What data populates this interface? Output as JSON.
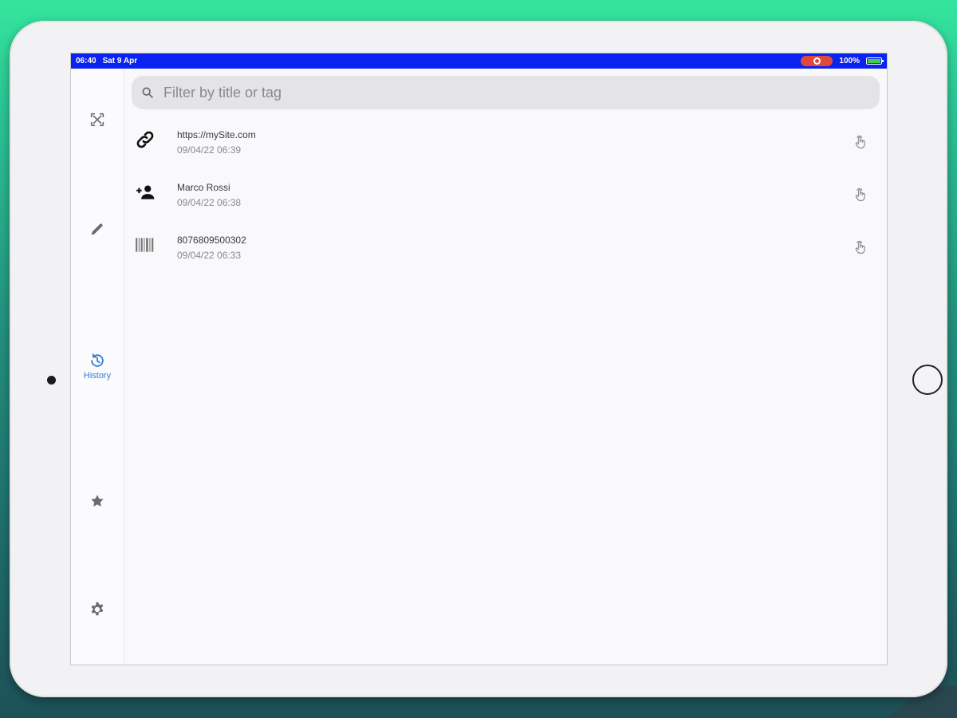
{
  "status_bar": {
    "time": "06:40",
    "date": "Sat 9 Apr",
    "battery_percent": "100%",
    "colors": {
      "background": "#0a23f0",
      "record_pill": "#e0483e",
      "battery": "#3ccf4e"
    }
  },
  "sidebar": {
    "items": [
      {
        "icon": "qr-scan-icon",
        "label": "",
        "active": false
      },
      {
        "icon": "pencil-icon",
        "label": "",
        "active": false
      },
      {
        "icon": "history-icon",
        "label": "History",
        "active": true
      },
      {
        "icon": "star-icon",
        "label": "",
        "active": false
      },
      {
        "icon": "gear-icon",
        "label": "",
        "active": false
      }
    ],
    "active_color": "#2f7fd8"
  },
  "search": {
    "placeholder": "Filter by title or tag",
    "value": ""
  },
  "history": {
    "items": [
      {
        "icon": "link-icon",
        "title": "https://mySite.com",
        "date": "09/04/22 06:39",
        "action_icon": "tap-hand-icon"
      },
      {
        "icon": "add-contact-icon",
        "title": "Marco Rossi",
        "date": "09/04/22 06:38",
        "action_icon": "tap-hand-icon"
      },
      {
        "icon": "barcode-icon",
        "title": "8076809500302",
        "date": "09/04/22 06:33",
        "action_icon": "tap-hand-icon"
      }
    ]
  }
}
